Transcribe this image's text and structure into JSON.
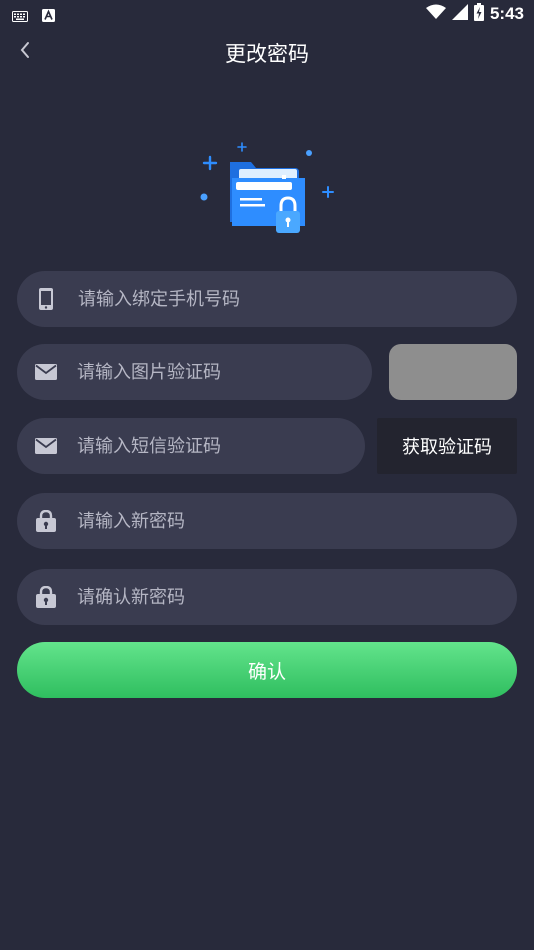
{
  "status_bar": {
    "time": "5:43",
    "icons": [
      "keyboard-icon",
      "a-notification-icon",
      "wifi-icon",
      "signal-icon",
      "battery-charging-icon"
    ]
  },
  "header": {
    "title": "更改密码",
    "back_icon": "chevron-left-icon"
  },
  "form": {
    "phone": {
      "placeholder": "请输入绑定手机号码",
      "value": "",
      "icon": "phone-icon"
    },
    "image_captcha": {
      "placeholder": "请输入图片验证码",
      "value": "",
      "icon": "mail-icon"
    },
    "sms_code": {
      "placeholder": "请输入短信验证码",
      "value": "",
      "icon": "mail-icon"
    },
    "new_password": {
      "placeholder": "请输入新密码",
      "value": "",
      "icon": "lock-icon"
    },
    "confirm_password": {
      "placeholder": "请确认新密码",
      "value": "",
      "icon": "lock-icon"
    },
    "get_code_label": "获取验证码",
    "submit_label": "确认"
  },
  "colors": {
    "background": "#282a3b",
    "field_bg": "#3a3c50",
    "accent_green": "#3fd06f",
    "illustration_blue": "#2e8dff"
  }
}
